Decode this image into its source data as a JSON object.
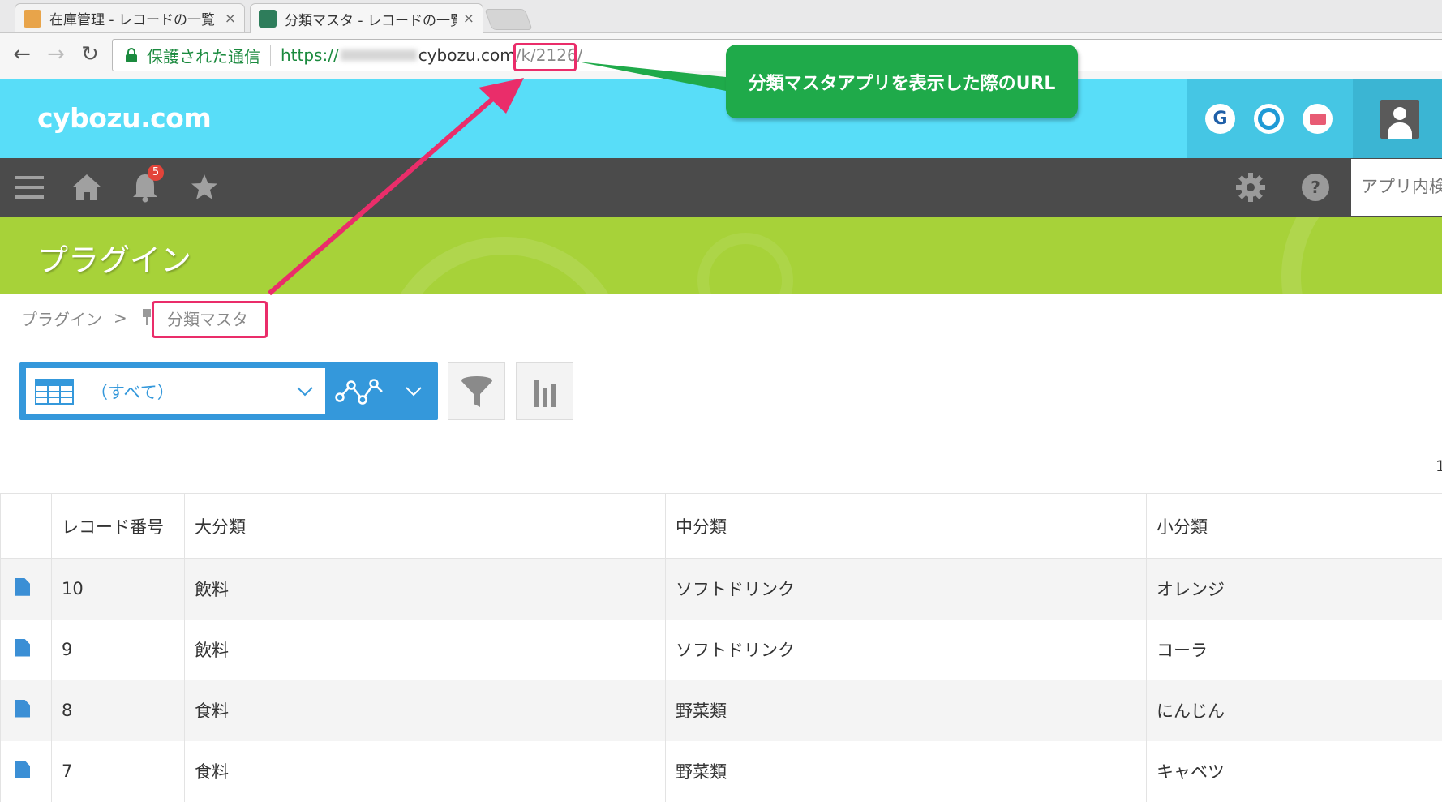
{
  "browser": {
    "tabs": [
      {
        "title": "在庫管理 - レコードの一覧",
        "close": "×",
        "favicon_color": "#e8a44a"
      },
      {
        "title": "分類マスタ - レコードの一覧",
        "close": "×",
        "favicon_color": "#2e7d5b"
      }
    ],
    "secure_label": "保護された通信",
    "url_scheme": "https://",
    "url_host": "cybozu.com",
    "url_path": "/k/",
    "url_app_id": "2126/"
  },
  "header": {
    "logo": "cybozu.com",
    "app_icons": [
      {
        "name": "garoon",
        "glyph": "G",
        "color": "#1f5fa8"
      },
      {
        "name": "office",
        "glyph": "O",
        "color": "#1f9ad6"
      },
      {
        "name": "mailwise",
        "glyph": "✉",
        "color": "#e85b74"
      }
    ],
    "notification_count": "5",
    "app_search_placeholder": "アプリ内検索"
  },
  "page": {
    "title": "プラグイン",
    "breadcrumb": [
      "プラグイン",
      ">",
      "分類マスタ"
    ],
    "view_selector": "（すべて）",
    "pager_fragment": "1"
  },
  "table": {
    "columns": [
      "",
      "レコード番号",
      "大分類",
      "中分類",
      "小分類"
    ],
    "rows": [
      {
        "id": "10",
        "major": "飲料",
        "middle": "ソフトドリンク",
        "minor": "オレンジ"
      },
      {
        "id": "9",
        "major": "飲料",
        "middle": "ソフトドリンク",
        "minor": "コーラ"
      },
      {
        "id": "8",
        "major": "食料",
        "middle": "野菜類",
        "minor": "にんじん"
      },
      {
        "id": "7",
        "major": "食料",
        "middle": "野菜類",
        "minor": "キャベツ"
      }
    ]
  },
  "annotation": {
    "callout_text": "分類マスタアプリを表示した際のURL",
    "callout_color": "#1faa4a",
    "highlight_color": "#ea2d6a"
  }
}
